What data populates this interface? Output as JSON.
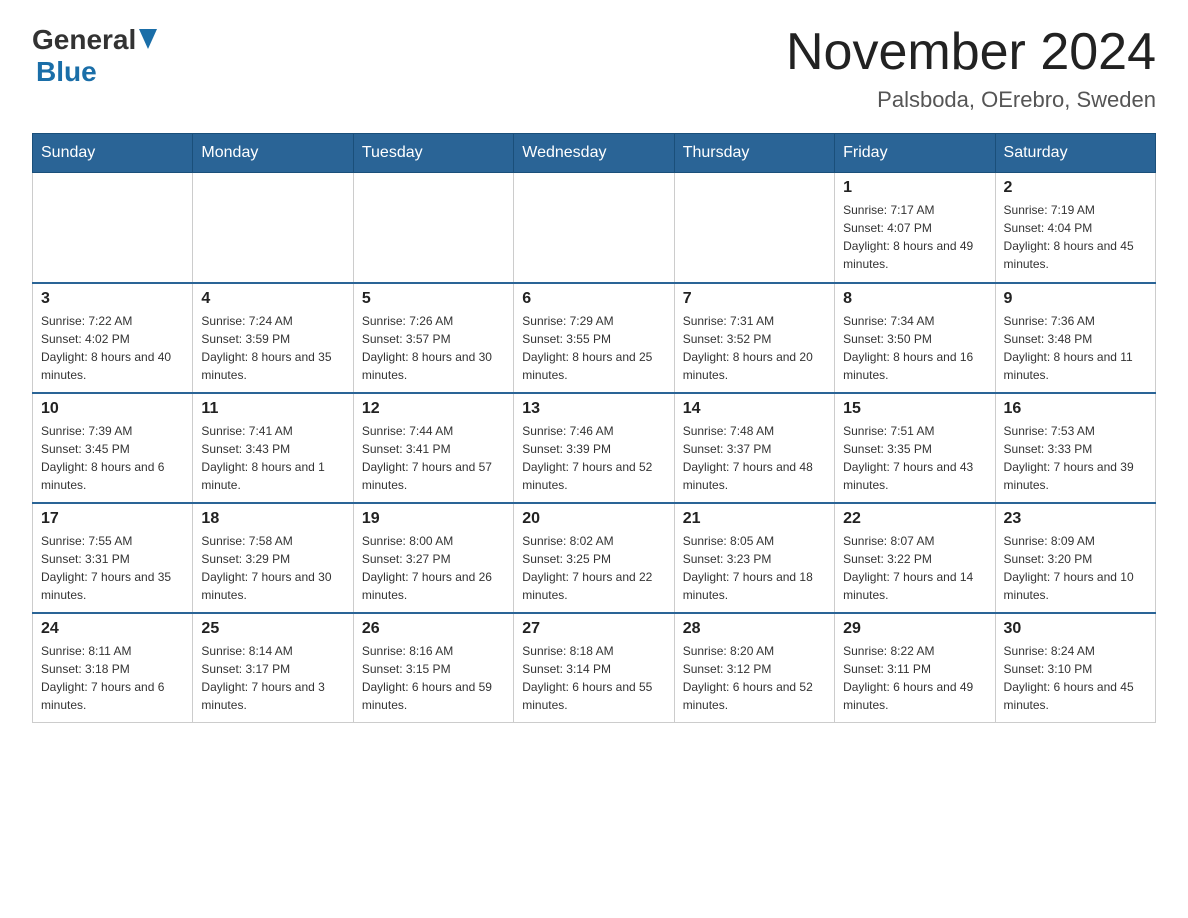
{
  "header": {
    "logo_general": "General",
    "logo_blue": "Blue",
    "month_title": "November 2024",
    "location": "Palsboda, OErebro, Sweden"
  },
  "weekdays": [
    "Sunday",
    "Monday",
    "Tuesday",
    "Wednesday",
    "Thursday",
    "Friday",
    "Saturday"
  ],
  "weeks": [
    [
      {
        "day": "",
        "sunrise": "",
        "sunset": "",
        "daylight": ""
      },
      {
        "day": "",
        "sunrise": "",
        "sunset": "",
        "daylight": ""
      },
      {
        "day": "",
        "sunrise": "",
        "sunset": "",
        "daylight": ""
      },
      {
        "day": "",
        "sunrise": "",
        "sunset": "",
        "daylight": ""
      },
      {
        "day": "",
        "sunrise": "",
        "sunset": "",
        "daylight": ""
      },
      {
        "day": "1",
        "sunrise": "Sunrise: 7:17 AM",
        "sunset": "Sunset: 4:07 PM",
        "daylight": "Daylight: 8 hours and 49 minutes."
      },
      {
        "day": "2",
        "sunrise": "Sunrise: 7:19 AM",
        "sunset": "Sunset: 4:04 PM",
        "daylight": "Daylight: 8 hours and 45 minutes."
      }
    ],
    [
      {
        "day": "3",
        "sunrise": "Sunrise: 7:22 AM",
        "sunset": "Sunset: 4:02 PM",
        "daylight": "Daylight: 8 hours and 40 minutes."
      },
      {
        "day": "4",
        "sunrise": "Sunrise: 7:24 AM",
        "sunset": "Sunset: 3:59 PM",
        "daylight": "Daylight: 8 hours and 35 minutes."
      },
      {
        "day": "5",
        "sunrise": "Sunrise: 7:26 AM",
        "sunset": "Sunset: 3:57 PM",
        "daylight": "Daylight: 8 hours and 30 minutes."
      },
      {
        "day": "6",
        "sunrise": "Sunrise: 7:29 AM",
        "sunset": "Sunset: 3:55 PM",
        "daylight": "Daylight: 8 hours and 25 minutes."
      },
      {
        "day": "7",
        "sunrise": "Sunrise: 7:31 AM",
        "sunset": "Sunset: 3:52 PM",
        "daylight": "Daylight: 8 hours and 20 minutes."
      },
      {
        "day": "8",
        "sunrise": "Sunrise: 7:34 AM",
        "sunset": "Sunset: 3:50 PM",
        "daylight": "Daylight: 8 hours and 16 minutes."
      },
      {
        "day": "9",
        "sunrise": "Sunrise: 7:36 AM",
        "sunset": "Sunset: 3:48 PM",
        "daylight": "Daylight: 8 hours and 11 minutes."
      }
    ],
    [
      {
        "day": "10",
        "sunrise": "Sunrise: 7:39 AM",
        "sunset": "Sunset: 3:45 PM",
        "daylight": "Daylight: 8 hours and 6 minutes."
      },
      {
        "day": "11",
        "sunrise": "Sunrise: 7:41 AM",
        "sunset": "Sunset: 3:43 PM",
        "daylight": "Daylight: 8 hours and 1 minute."
      },
      {
        "day": "12",
        "sunrise": "Sunrise: 7:44 AM",
        "sunset": "Sunset: 3:41 PM",
        "daylight": "Daylight: 7 hours and 57 minutes."
      },
      {
        "day": "13",
        "sunrise": "Sunrise: 7:46 AM",
        "sunset": "Sunset: 3:39 PM",
        "daylight": "Daylight: 7 hours and 52 minutes."
      },
      {
        "day": "14",
        "sunrise": "Sunrise: 7:48 AM",
        "sunset": "Sunset: 3:37 PM",
        "daylight": "Daylight: 7 hours and 48 minutes."
      },
      {
        "day": "15",
        "sunrise": "Sunrise: 7:51 AM",
        "sunset": "Sunset: 3:35 PM",
        "daylight": "Daylight: 7 hours and 43 minutes."
      },
      {
        "day": "16",
        "sunrise": "Sunrise: 7:53 AM",
        "sunset": "Sunset: 3:33 PM",
        "daylight": "Daylight: 7 hours and 39 minutes."
      }
    ],
    [
      {
        "day": "17",
        "sunrise": "Sunrise: 7:55 AM",
        "sunset": "Sunset: 3:31 PM",
        "daylight": "Daylight: 7 hours and 35 minutes."
      },
      {
        "day": "18",
        "sunrise": "Sunrise: 7:58 AM",
        "sunset": "Sunset: 3:29 PM",
        "daylight": "Daylight: 7 hours and 30 minutes."
      },
      {
        "day": "19",
        "sunrise": "Sunrise: 8:00 AM",
        "sunset": "Sunset: 3:27 PM",
        "daylight": "Daylight: 7 hours and 26 minutes."
      },
      {
        "day": "20",
        "sunrise": "Sunrise: 8:02 AM",
        "sunset": "Sunset: 3:25 PM",
        "daylight": "Daylight: 7 hours and 22 minutes."
      },
      {
        "day": "21",
        "sunrise": "Sunrise: 8:05 AM",
        "sunset": "Sunset: 3:23 PM",
        "daylight": "Daylight: 7 hours and 18 minutes."
      },
      {
        "day": "22",
        "sunrise": "Sunrise: 8:07 AM",
        "sunset": "Sunset: 3:22 PM",
        "daylight": "Daylight: 7 hours and 14 minutes."
      },
      {
        "day": "23",
        "sunrise": "Sunrise: 8:09 AM",
        "sunset": "Sunset: 3:20 PM",
        "daylight": "Daylight: 7 hours and 10 minutes."
      }
    ],
    [
      {
        "day": "24",
        "sunrise": "Sunrise: 8:11 AM",
        "sunset": "Sunset: 3:18 PM",
        "daylight": "Daylight: 7 hours and 6 minutes."
      },
      {
        "day": "25",
        "sunrise": "Sunrise: 8:14 AM",
        "sunset": "Sunset: 3:17 PM",
        "daylight": "Daylight: 7 hours and 3 minutes."
      },
      {
        "day": "26",
        "sunrise": "Sunrise: 8:16 AM",
        "sunset": "Sunset: 3:15 PM",
        "daylight": "Daylight: 6 hours and 59 minutes."
      },
      {
        "day": "27",
        "sunrise": "Sunrise: 8:18 AM",
        "sunset": "Sunset: 3:14 PM",
        "daylight": "Daylight: 6 hours and 55 minutes."
      },
      {
        "day": "28",
        "sunrise": "Sunrise: 8:20 AM",
        "sunset": "Sunset: 3:12 PM",
        "daylight": "Daylight: 6 hours and 52 minutes."
      },
      {
        "day": "29",
        "sunrise": "Sunrise: 8:22 AM",
        "sunset": "Sunset: 3:11 PM",
        "daylight": "Daylight: 6 hours and 49 minutes."
      },
      {
        "day": "30",
        "sunrise": "Sunrise: 8:24 AM",
        "sunset": "Sunset: 3:10 PM",
        "daylight": "Daylight: 6 hours and 45 minutes."
      }
    ]
  ]
}
